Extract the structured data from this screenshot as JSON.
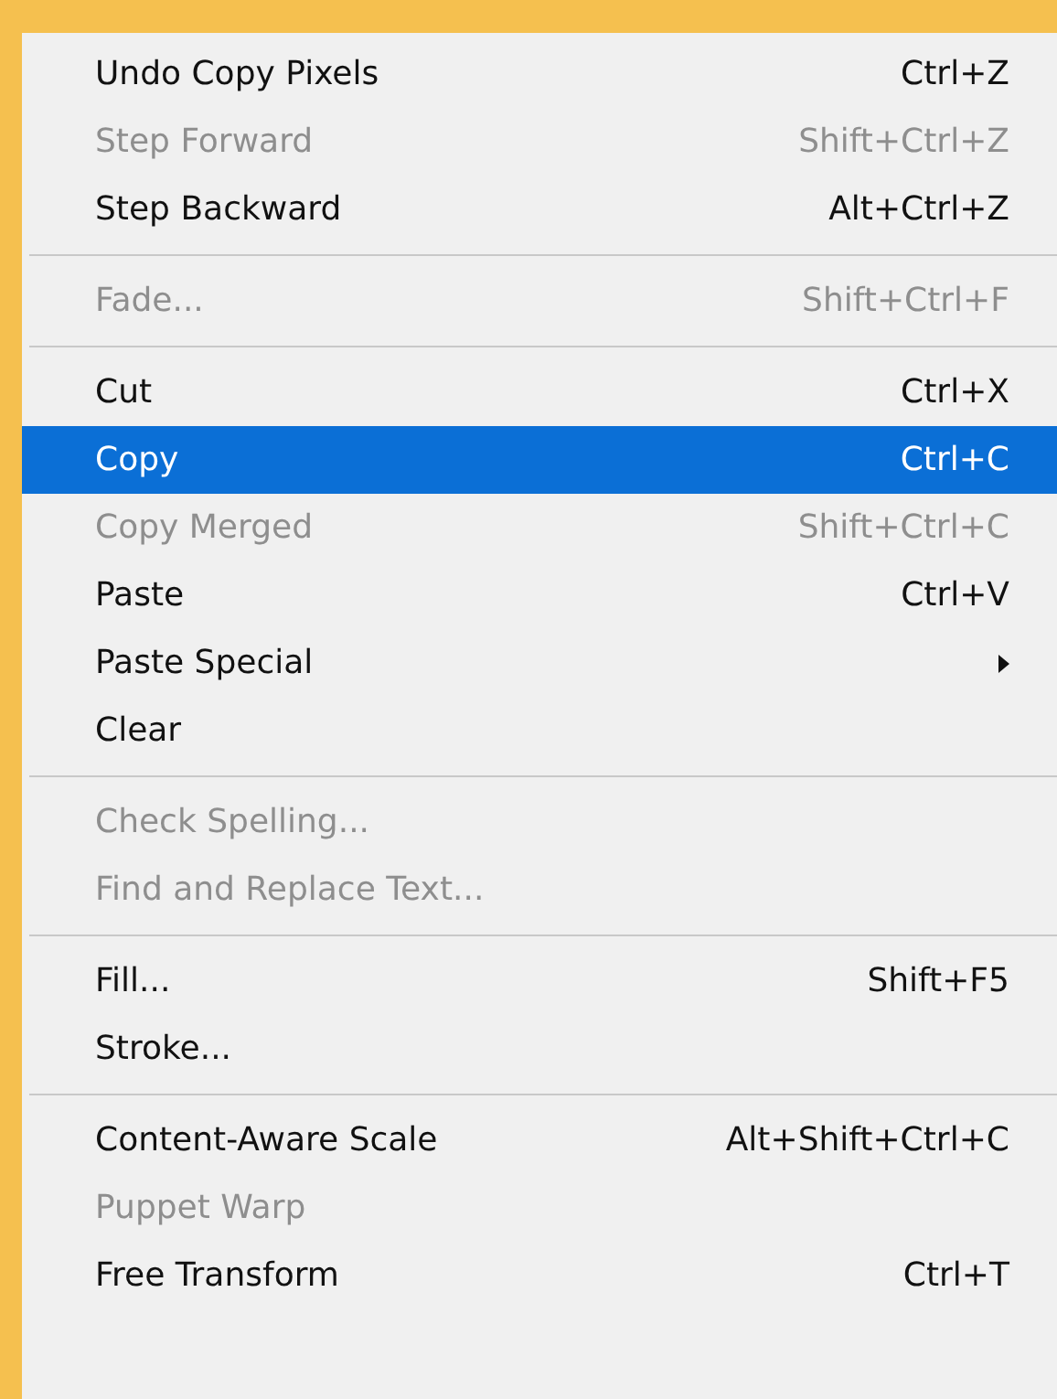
{
  "menu": {
    "items": [
      {
        "kind": "item",
        "label": "Undo Copy Pixels",
        "shortcut": "Ctrl+Z",
        "disabled": false,
        "selected": false
      },
      {
        "kind": "item",
        "label": "Step Forward",
        "shortcut": "Shift+Ctrl+Z",
        "disabled": true,
        "selected": false
      },
      {
        "kind": "item",
        "label": "Step Backward",
        "shortcut": "Alt+Ctrl+Z",
        "disabled": false,
        "selected": false
      },
      {
        "kind": "separator"
      },
      {
        "kind": "item",
        "label": "Fade...",
        "shortcut": "Shift+Ctrl+F",
        "disabled": true,
        "selected": false
      },
      {
        "kind": "separator"
      },
      {
        "kind": "item",
        "label": "Cut",
        "shortcut": "Ctrl+X",
        "disabled": false,
        "selected": false
      },
      {
        "kind": "item",
        "label": "Copy",
        "shortcut": "Ctrl+C",
        "disabled": false,
        "selected": true
      },
      {
        "kind": "item",
        "label": "Copy Merged",
        "shortcut": "Shift+Ctrl+C",
        "disabled": true,
        "selected": false
      },
      {
        "kind": "item",
        "label": "Paste",
        "shortcut": "Ctrl+V",
        "disabled": false,
        "selected": false
      },
      {
        "kind": "submenu",
        "label": "Paste Special",
        "disabled": false,
        "selected": false
      },
      {
        "kind": "item",
        "label": "Clear",
        "disabled": false,
        "selected": false
      },
      {
        "kind": "separator"
      },
      {
        "kind": "item",
        "label": "Check Spelling...",
        "disabled": true,
        "selected": false
      },
      {
        "kind": "item",
        "label": "Find and Replace Text...",
        "disabled": true,
        "selected": false
      },
      {
        "kind": "separator"
      },
      {
        "kind": "item",
        "label": "Fill...",
        "shortcut": "Shift+F5",
        "disabled": false,
        "selected": false
      },
      {
        "kind": "item",
        "label": "Stroke...",
        "disabled": false,
        "selected": false
      },
      {
        "kind": "separator"
      },
      {
        "kind": "item",
        "label": "Content-Aware Scale",
        "shortcut": "Alt+Shift+Ctrl+C",
        "disabled": false,
        "selected": false
      },
      {
        "kind": "item",
        "label": "Puppet Warp",
        "disabled": true,
        "selected": false
      },
      {
        "kind": "item",
        "label": "Free Transform",
        "shortcut": "Ctrl+T",
        "disabled": false,
        "selected": false
      }
    ]
  }
}
